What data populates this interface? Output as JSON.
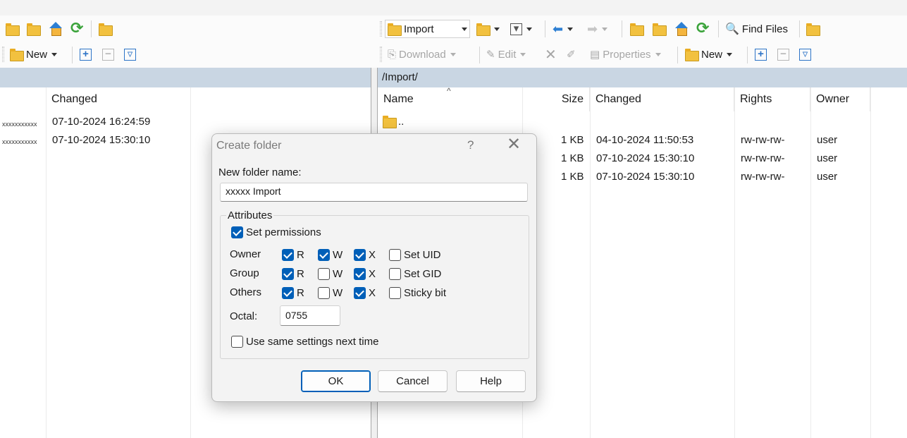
{
  "toolbar": {
    "left_new_label": "New",
    "right_location": "Import",
    "find_files_label": "Find Files",
    "download_label": "Download",
    "edit_label": "Edit",
    "properties_label": "Properties",
    "right_new_label": "New"
  },
  "left_panel": {
    "columns": {
      "changed": "Changed"
    },
    "rows": [
      {
        "name": "xxxxxxxxxxx",
        "changed": "07-10-2024 16:24:59"
      },
      {
        "name": "xxxxxxxxxxx",
        "changed": "07-10-2024 15:30:10"
      }
    ]
  },
  "right_panel": {
    "path": "/Import/",
    "columns": {
      "name": "Name",
      "size": "Size",
      "changed": "Changed",
      "rights": "Rights",
      "owner": "Owner"
    },
    "parent_dir": "..",
    "rows": [
      {
        "size": "1 KB",
        "changed": "04-10-2024 11:50:53",
        "rights": "rw-rw-rw-",
        "owner": "user"
      },
      {
        "size": "1 KB",
        "changed": "07-10-2024 15:30:10",
        "rights": "rw-rw-rw-",
        "owner": "user"
      },
      {
        "size": "1 KB",
        "changed": "07-10-2024 15:30:10",
        "rights": "rw-rw-rw-",
        "owner": "user"
      }
    ]
  },
  "dialog": {
    "title": "Create folder",
    "help_glyph": "?",
    "close_glyph": "✕",
    "folder_name_label": "New folder name:",
    "folder_name_value": "xxxxx Import",
    "attributes_caption": "Attributes",
    "set_permissions_label": "Set permissions",
    "rows": {
      "owner": "Owner",
      "group": "Group",
      "others": "Others"
    },
    "perm_labels": {
      "r": "R",
      "w": "W",
      "x": "X"
    },
    "set_uid_label": "Set UID",
    "set_gid_label": "Set GID",
    "sticky_label": "Sticky bit",
    "octal_label": "Octal:",
    "octal_value": "0755",
    "same_settings_label": "Use same settings next time",
    "ok_label": "OK",
    "cancel_label": "Cancel",
    "help_label": "Help"
  }
}
